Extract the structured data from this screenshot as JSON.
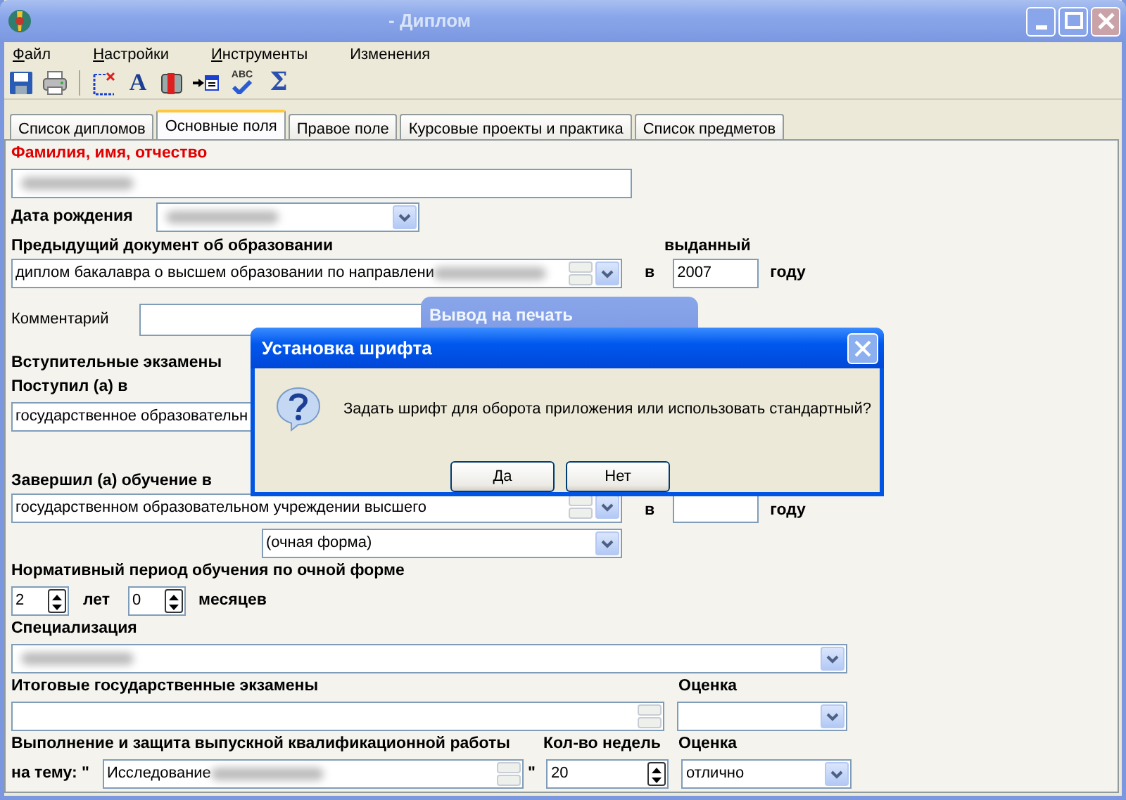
{
  "window": {
    "title": "- Диплом"
  },
  "menu": [
    {
      "label": "Файл",
      "mnemonic": true
    },
    {
      "label": "Настройки",
      "mnemonic": true
    },
    {
      "label": "Инструменты",
      "mnemonic": true
    },
    {
      "label": "Изменения",
      "mnemonic": false
    }
  ],
  "toolbar": [
    {
      "kind": "save"
    },
    {
      "kind": "print"
    },
    {
      "kind": "separator"
    },
    {
      "kind": "frame"
    },
    {
      "kind": "font",
      "glyph": "A"
    },
    {
      "kind": "book"
    },
    {
      "kind": "import"
    },
    {
      "kind": "spell",
      "glyph": "ABC"
    },
    {
      "kind": "sum",
      "glyph": "Σ"
    }
  ],
  "tabs": [
    {
      "label": "Список дипломов",
      "selected": false
    },
    {
      "label": "Основные поля",
      "selected": true
    },
    {
      "label": "Правое поле",
      "selected": false
    },
    {
      "label": "Курсовые проекты и практика",
      "selected": false
    },
    {
      "label": "Список предметов",
      "selected": false
    }
  ],
  "form": {
    "full_name": {
      "label": "Фамилия, имя, отчество",
      "redacted": true
    },
    "birth_date": {
      "label": "Дата рождения",
      "redacted": true
    },
    "prev_doc": {
      "label": "Предыдущий документ об образовании",
      "value": "диплом бакалавра о высшем образовании по направлени",
      "redacted": true,
      "issued_label": "выданный",
      "in_label": "в",
      "year": "2007",
      "year_suffix": "году"
    },
    "comment_label": "Комментарий",
    "entrance_exams_label": "Вступительные экзамены",
    "enrolled": {
      "label": "Поступил (а) в",
      "value": "государственное образовательн"
    },
    "graduated": {
      "label": "Завершил (а) обучение в",
      "value": "государственном образовательном учреждении высшего",
      "in_label": "в",
      "year_suffix": "году",
      "study_form": "(очная форма)"
    },
    "period": {
      "label": "Нормативный период обучения по очной форме",
      "years": "2",
      "years_label": "лет",
      "months": "0",
      "months_label": "месяцев"
    },
    "specialization": {
      "label": "Специализация",
      "redacted": true
    },
    "final_exams": {
      "label": "Итоговые государственные экзамены",
      "grade_label": "Оценка"
    },
    "thesis": {
      "label": "Выполнение и защита выпускной квалификационной работы",
      "topic_label": "на тему: \"",
      "topic": "Исследование",
      "redacted": true,
      "close_quote": "\"",
      "weeks_label": "Кол-во недель",
      "weeks": "20",
      "grade_label": "Оценка",
      "grade": "отлично"
    }
  },
  "background_window": {
    "title": "Вывод на печать"
  },
  "dialog": {
    "title": "Установка шрифта",
    "message": "Задать шрифт для оборота приложения или использовать стандартный?",
    "buttons": [
      {
        "label": "Да"
      },
      {
        "label": "Нет"
      }
    ]
  }
}
